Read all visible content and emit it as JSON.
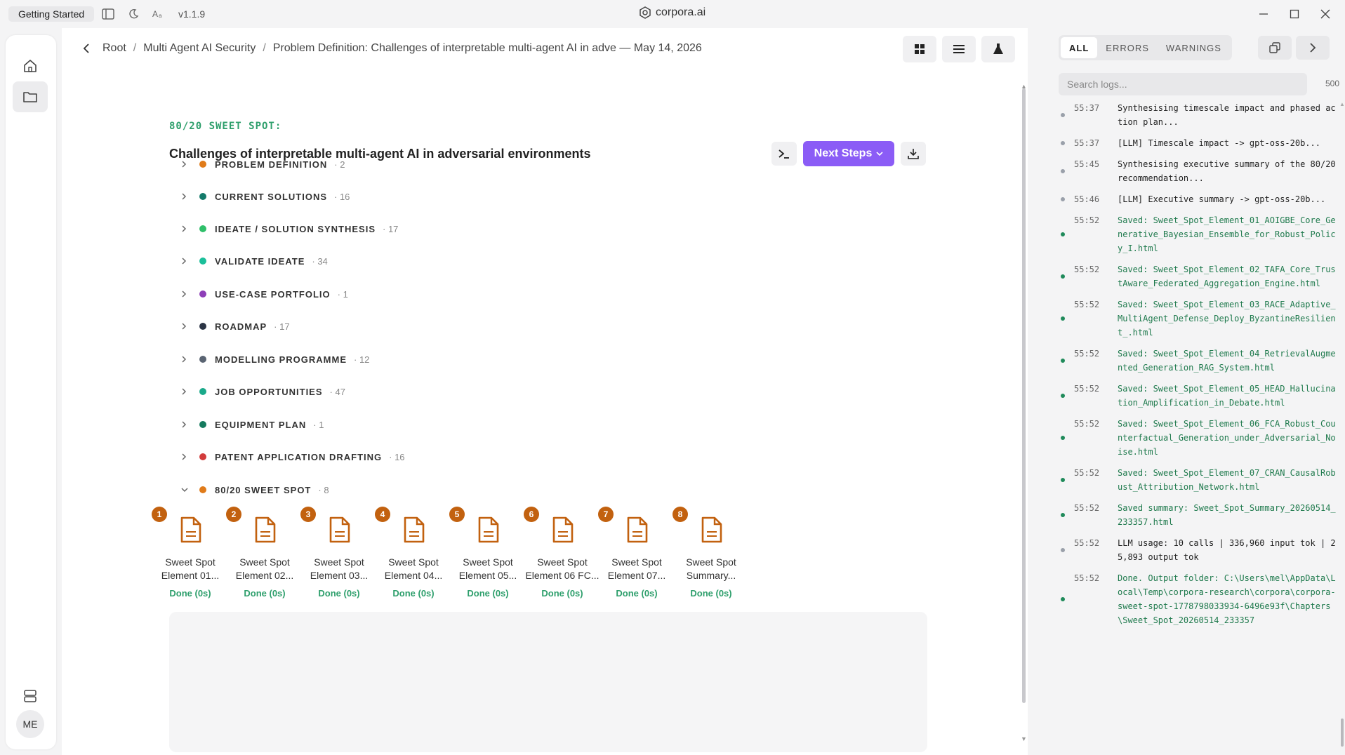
{
  "titlebar": {
    "getting_started": "Getting Started",
    "version": "v1.1.9",
    "brand": "corpora.ai"
  },
  "rail": {
    "avatar": "ME"
  },
  "breadcrumb": [
    "Root",
    "Multi Agent AI Security",
    "Problem Definition: Challenges of interpretable multi-agent AI in adve — May 14, 2026"
  ],
  "content": {
    "label": "80/20 SWEET SPOT:",
    "title": "Challenges of interpretable multi-agent AI in adversarial environments",
    "next_steps": "Next Steps",
    "sections": [
      {
        "name": "PROBLEM DEFINITION",
        "count": "· 2",
        "color": "#e07b1a"
      },
      {
        "name": "CURRENT SOLUTIONS",
        "count": "· 16",
        "color": "#147a6a"
      },
      {
        "name": "IDEATE / SOLUTION SYNTHESIS",
        "count": "· 17",
        "color": "#2fbf6a"
      },
      {
        "name": "VALIDATE IDEATE",
        "count": "· 34",
        "color": "#1bbf9a"
      },
      {
        "name": "USE-CASE PORTFOLIO",
        "count": "· 1",
        "color": "#8e3fb8"
      },
      {
        "name": "ROADMAP",
        "count": "· 17",
        "color": "#2b3445"
      },
      {
        "name": "MODELLING PROGRAMME",
        "count": "· 12",
        "color": "#5a6472"
      },
      {
        "name": "JOB OPPORTUNITIES",
        "count": "· 47",
        "color": "#1aa98a"
      },
      {
        "name": "EQUIPMENT PLAN",
        "count": "· 1",
        "color": "#157a5e"
      },
      {
        "name": "PATENT APPLICATION DRAFTING",
        "count": "· 16",
        "color": "#d23b3b"
      },
      {
        "name": "80/20 SWEET SPOT",
        "count": "· 8",
        "color": "#e07b1a"
      }
    ],
    "files": [
      {
        "num": "1",
        "line1": "Sweet Spot",
        "line2": "Element 01...",
        "status": "Done (0s)"
      },
      {
        "num": "2",
        "line1": "Sweet Spot",
        "line2": "Element 02...",
        "status": "Done (0s)"
      },
      {
        "num": "3",
        "line1": "Sweet Spot",
        "line2": "Element 03...",
        "status": "Done (0s)"
      },
      {
        "num": "4",
        "line1": "Sweet Spot",
        "line2": "Element 04...",
        "status": "Done (0s)"
      },
      {
        "num": "5",
        "line1": "Sweet Spot",
        "line2": "Element 05...",
        "status": "Done (0s)"
      },
      {
        "num": "6",
        "line1": "Sweet Spot",
        "line2": "Element 06 FC...",
        "status": "Done (0s)"
      },
      {
        "num": "7",
        "line1": "Sweet Spot",
        "line2": "Element 07...",
        "status": "Done (0s)"
      },
      {
        "num": "8",
        "line1": "Sweet Spot",
        "line2": "Summary...",
        "status": "Done (0s)"
      }
    ]
  },
  "logs": {
    "tabs": [
      "ALL",
      "ERRORS",
      "WARNINGS"
    ],
    "search_placeholder": "Search logs...",
    "limit": "500",
    "dot_colors": {
      "info": "#9aa0aa",
      "ok": "#1f8a5a"
    },
    "entries": [
      {
        "time": "55:37",
        "msg": "Synthesising timescale impact and phased action plan...",
        "kind": "info"
      },
      {
        "time": "55:37",
        "msg": "[LLM] Timescale impact -> gpt-oss-20b...",
        "kind": "info"
      },
      {
        "time": "55:45",
        "msg": "Synthesising executive summary of the 80/20 recommendation...",
        "kind": "info"
      },
      {
        "time": "55:46",
        "msg": "[LLM] Executive summary -> gpt-oss-20b...",
        "kind": "info"
      },
      {
        "time": "55:52",
        "msg": "Saved: Sweet_Spot_Element_01_AOIGBE_Core_Generative_Bayesian_Ensemble_for_Robust_Policy_I.html",
        "kind": "ok"
      },
      {
        "time": "55:52",
        "msg": "Saved: Sweet_Spot_Element_02_TAFA_Core_TrustAware_Federated_Aggregation_Engine.html",
        "kind": "ok"
      },
      {
        "time": "55:52",
        "msg": "Saved: Sweet_Spot_Element_03_RACE_Adaptive_MultiAgent_Defense_Deploy_ByzantineResilient_.html",
        "kind": "ok"
      },
      {
        "time": "55:52",
        "msg": "Saved: Sweet_Spot_Element_04_RetrievalAugmented_Generation_RAG_System.html",
        "kind": "ok"
      },
      {
        "time": "55:52",
        "msg": "Saved: Sweet_Spot_Element_05_HEAD_Hallucination_Amplification_in_Debate.html",
        "kind": "ok"
      },
      {
        "time": "55:52",
        "msg": "Saved: Sweet_Spot_Element_06_FCA_Robust_Counterfactual_Generation_under_Adversarial_Noise.html",
        "kind": "ok"
      },
      {
        "time": "55:52",
        "msg": "Saved: Sweet_Spot_Element_07_CRAN_CausalRobust_Attribution_Network.html",
        "kind": "ok"
      },
      {
        "time": "55:52",
        "msg": "Saved summary: Sweet_Spot_Summary_20260514_233357.html",
        "kind": "ok"
      },
      {
        "time": "55:52",
        "msg": "LLM usage: 10 calls | 336,960 input tok | 25,893 output tok",
        "kind": "info"
      },
      {
        "time": "55:52",
        "msg": "Done. Output folder: C:\\Users\\mel\\AppData\\Local\\Temp\\corpora-research\\corpora\\corpora-sweet-spot-1778798033934-6496e93f\\Chapters\\Sweet_Spot_20260514_233357",
        "kind": "ok"
      }
    ]
  }
}
